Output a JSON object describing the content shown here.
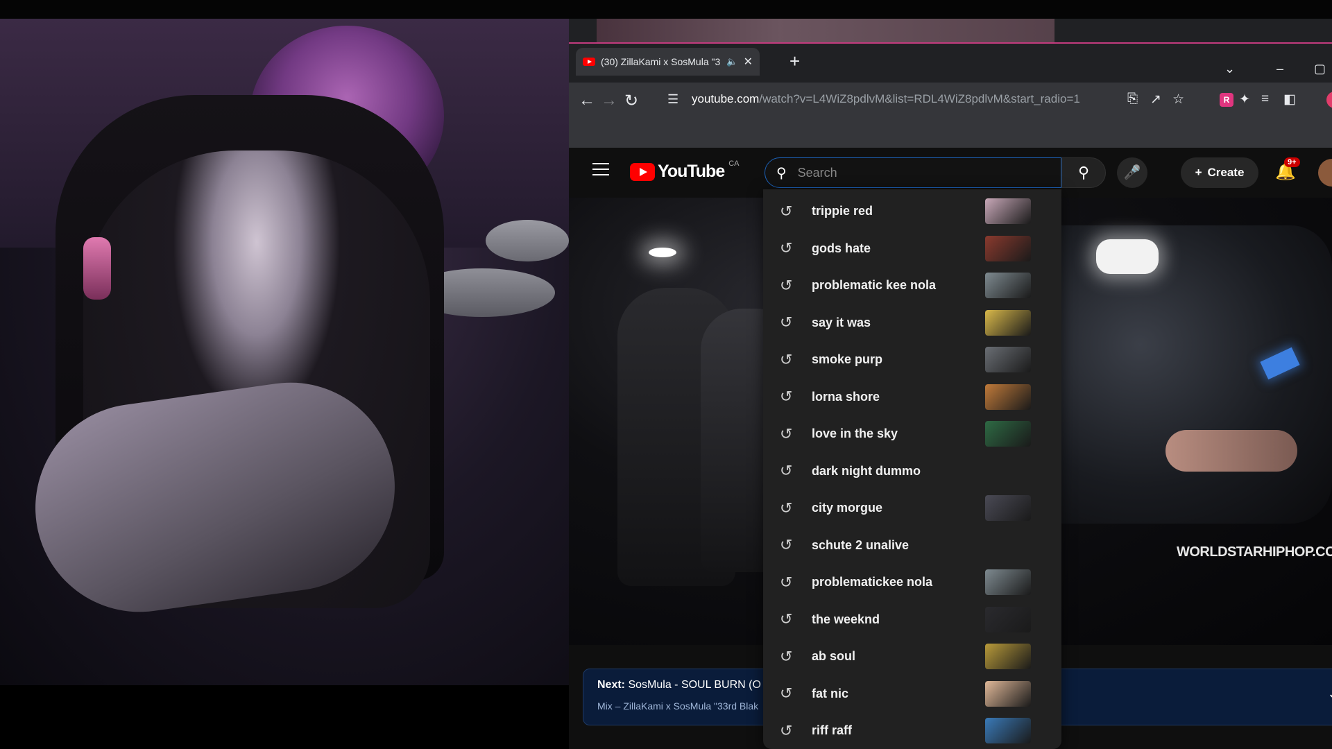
{
  "browser": {
    "tab": {
      "title": "(30) ZillaKami x SosMula \"3:",
      "audio_icon": "speaker-icon",
      "close_icon": "close-icon"
    },
    "new_tab_icon": "plus-icon",
    "url_host": "youtube.com",
    "url_rest": "/watch?v=L4WiZ8pdlvM&list=RDL4WiZ8pdlvM&start_radio=1"
  },
  "youtube": {
    "logo_text": "YouTube",
    "country_code": "CA",
    "search_placeholder": "Search",
    "create_label": "Create",
    "notification_badge": "9+"
  },
  "video": {
    "watermark": "WORLDSTARHIPHOP.COM"
  },
  "up_next": {
    "prefix": "Next:",
    "title": "SosMula - SOUL BURN (O",
    "subtitle": "Mix – ZillaKami x SosMula \"33rd Blak"
  },
  "suggestions": [
    {
      "text": "trippie red",
      "thumb_color": "#c8a8b8"
    },
    {
      "text": "gods hate",
      "thumb_color": "#8a3a2e"
    },
    {
      "text": "problematic kee nola",
      "thumb_color": "#7e8a90"
    },
    {
      "text": "say it was",
      "thumb_color": "#d8b84a"
    },
    {
      "text": "smoke purp",
      "thumb_color": "#6a6e74"
    },
    {
      "text": "lorna shore",
      "thumb_color": "#c07a3a"
    },
    {
      "text": "love in the sky",
      "thumb_color": "#2e6a44"
    },
    {
      "text": "dark night dummo",
      "thumb_color": ""
    },
    {
      "text": "city morgue",
      "thumb_color": "#4a4a55"
    },
    {
      "text": "schute 2 unalive",
      "thumb_color": ""
    },
    {
      "text": "problematickee nola",
      "thumb_color": "#7e8a90"
    },
    {
      "text": "the weeknd",
      "thumb_color": "#2a2a2e"
    },
    {
      "text": "ab soul",
      "thumb_color": "#b89a3a"
    },
    {
      "text": "fat nic",
      "thumb_color": "#e0b898"
    },
    {
      "text": "riff raff",
      "thumb_color": "#3a7ab8"
    }
  ],
  "colors": {
    "accent_blue": "#1c62b9",
    "youtube_red": "#ff0000",
    "background": "#0f0f0f"
  }
}
